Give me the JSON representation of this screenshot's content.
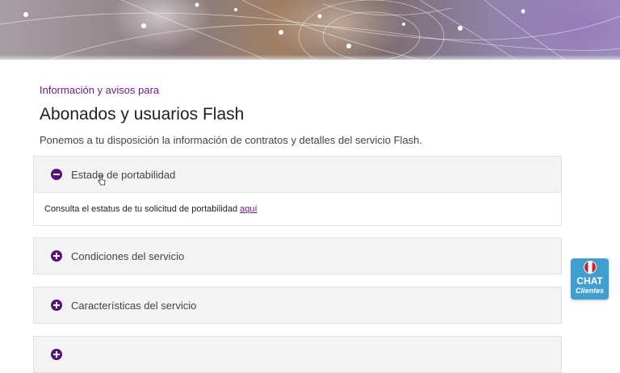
{
  "header": {
    "kicker": "Información y avisos para",
    "title": "Abonados y usuarios Flash",
    "description": "Ponemos a tu disposición la información de contratos y detalles del servicio Flash."
  },
  "accordion": [
    {
      "label": "Estado de portabilidad",
      "expanded": true,
      "icon": "minus-circle-icon",
      "content_text": "Consulta el estatus de tu solicitud de portabilidad",
      "content_link": "aquí"
    },
    {
      "label": "Condiciones del servicio",
      "expanded": false,
      "icon": "plus-circle-icon"
    },
    {
      "label": "Características del servicio",
      "expanded": false,
      "icon": "plus-circle-icon"
    },
    {
      "label": "",
      "expanded": false,
      "icon": "plus-circle-icon"
    }
  ],
  "chat_widget": {
    "line1": "CHAT",
    "line2": "Clientes",
    "icon": "peru-flag-icon"
  },
  "colors": {
    "accent": "#6b1c86",
    "icon_fill": "#5b0f7a",
    "chat_bg": "#3f9fd2",
    "panel_bg": "#f3f3f3"
  }
}
